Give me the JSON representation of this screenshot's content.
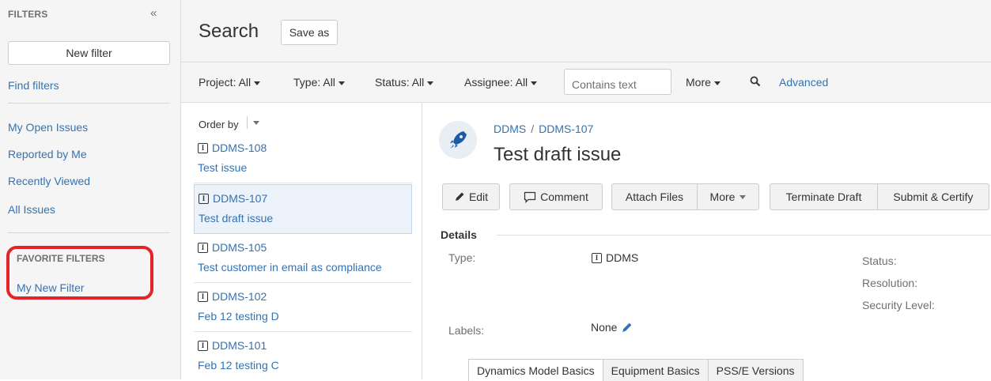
{
  "sidebar": {
    "title": "FILTERS",
    "collapse_glyph": "«",
    "new_filter_label": "New filter",
    "find_filters_label": "Find filters",
    "links": [
      "My Open Issues",
      "Reported by Me",
      "Recently Viewed",
      "All Issues"
    ],
    "favorite_title": "FAVORITE FILTERS",
    "favorite_items": [
      "My New Filter"
    ],
    "highlight_color": "#e3242b"
  },
  "header": {
    "title": "Search",
    "save_as_label": "Save as"
  },
  "filter_bar": {
    "project_label": "Project: All",
    "type_label": "Type: All",
    "status_label": "Status: All",
    "assignee_label": "Assignee: All",
    "text_placeholder": "Contains text",
    "more_label": "More",
    "advanced_label": "Advanced"
  },
  "issue_list": {
    "order_by_label": "Order by",
    "issues": [
      {
        "key": "DDMS-108",
        "summary": "Test issue"
      },
      {
        "key": "DDMS-107",
        "summary": "Test draft issue"
      },
      {
        "key": "DDMS-105",
        "summary": "Test customer in email as compliance"
      },
      {
        "key": "DDMS-102",
        "summary": "Feb 12 testing D"
      },
      {
        "key": "DDMS-101",
        "summary": "Feb 12 testing C"
      }
    ],
    "selected_index": 1
  },
  "detail": {
    "project": "DDMS",
    "issue_key": "DDMS-107",
    "title": "Test draft issue",
    "buttons": {
      "edit": "Edit",
      "comment": "Comment",
      "attach": "Attach Files",
      "more": "More",
      "terminate": "Terminate Draft",
      "submit": "Submit & Certify"
    },
    "details_heading": "Details",
    "fields": {
      "type_label": "Type:",
      "type_value": "DDMS",
      "labels_label": "Labels:",
      "labels_value": "None",
      "status_label": "Status:",
      "resolution_label": "Resolution:",
      "security_label": "Security Level:"
    },
    "tabs": [
      "Dynamics Model Basics",
      "Equipment Basics",
      "PSS/E Versions"
    ]
  }
}
